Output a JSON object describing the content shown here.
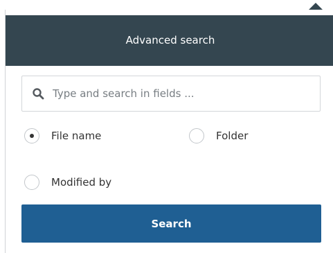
{
  "popover": {
    "title": "Advanced search"
  },
  "search": {
    "placeholder": "Type and search in fields ...",
    "value": "",
    "icon": "search-icon"
  },
  "radio_options": [
    {
      "label": "File name",
      "selected": true
    },
    {
      "label": "Folder",
      "selected": false
    },
    {
      "label": "Modified by",
      "selected": false
    }
  ],
  "actions": {
    "search_label": "Search"
  },
  "colors": {
    "header_bg": "#344650",
    "button_bg": "#1f5f93"
  }
}
